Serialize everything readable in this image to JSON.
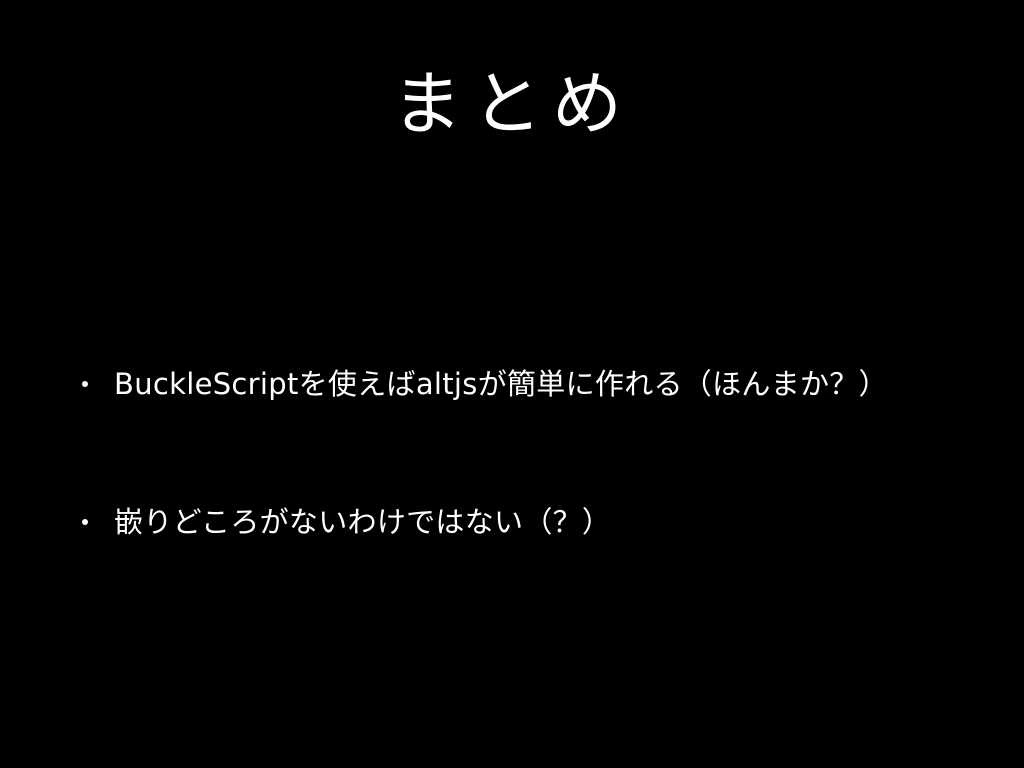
{
  "slide": {
    "title": "まとめ",
    "bullets": [
      "BuckleScriptを使えばaltjsが簡単に作れる（ほんまか？）",
      "嵌りどころがないわけではない（？）"
    ]
  },
  "colors": {
    "background": "#000000",
    "text": "#ffffff"
  }
}
